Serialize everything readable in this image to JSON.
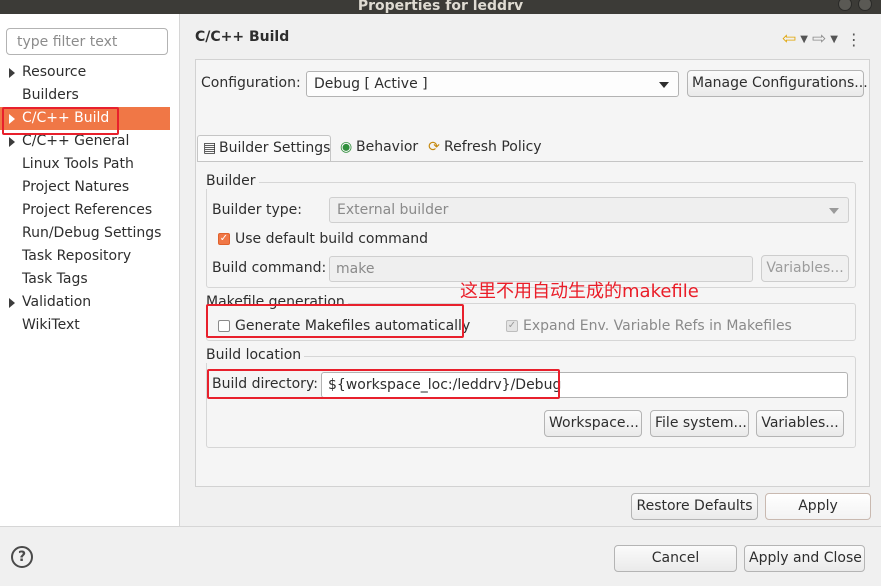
{
  "window": {
    "title": "Properties for leddrv"
  },
  "filter": {
    "placeholder": "type filter text"
  },
  "tree": {
    "items": [
      {
        "label": "Resource",
        "expandable": true
      },
      {
        "label": "Builders",
        "expandable": false
      },
      {
        "label": "C/C++ Build",
        "expandable": true,
        "selected": true
      },
      {
        "label": "C/C++ General",
        "expandable": true
      },
      {
        "label": "Linux Tools Path",
        "expandable": false
      },
      {
        "label": "Project Natures",
        "expandable": false
      },
      {
        "label": "Project References",
        "expandable": false
      },
      {
        "label": "Run/Debug Settings",
        "expandable": false
      },
      {
        "label": "Task Repository",
        "expandable": false
      },
      {
        "label": "Task Tags",
        "expandable": false
      },
      {
        "label": "Validation",
        "expandable": true
      },
      {
        "label": "WikiText",
        "expandable": false
      }
    ]
  },
  "page": {
    "title": "C/C++ Build"
  },
  "config": {
    "label": "Configuration:",
    "value": "Debug  [ Active ]",
    "manage_label": "Manage Configurations..."
  },
  "tabs": [
    {
      "label": "Builder Settings",
      "icon": "document-icon",
      "active": true
    },
    {
      "label": "Behavior",
      "icon": "radio-icon",
      "active": false
    },
    {
      "label": "Refresh Policy",
      "icon": "refresh-icon",
      "active": false
    }
  ],
  "builder": {
    "group_title": "Builder",
    "type_label": "Builder type:",
    "type_value": "External builder",
    "use_default_label": "Use default build command",
    "use_default_checked": true,
    "command_label": "Build command:",
    "command_value": "make",
    "variables_label": "Variables..."
  },
  "makefile": {
    "group_title": "Makefile generation",
    "generate_label": "Generate Makefiles automatically",
    "generate_checked": false,
    "expand_label": "Expand Env. Variable Refs in Makefiles",
    "expand_checked": true
  },
  "location": {
    "group_title": "Build location",
    "dir_label": "Build directory:",
    "dir_value": "${workspace_loc:/leddrv}/Debug",
    "workspace_label": "Workspace...",
    "filesystem_label": "File system...",
    "variables_label": "Variables..."
  },
  "annotation": {
    "text": "这里不用自动生成的makefile"
  },
  "actions": {
    "restore_label": "Restore Defaults",
    "apply_label": "Apply",
    "cancel_label": "Cancel",
    "apply_close_label": "Apply and Close",
    "help_glyph": "?"
  },
  "colors": {
    "selection": "#f07746",
    "annotation": "#ea1d28",
    "titlebar": "#3c3b37"
  }
}
